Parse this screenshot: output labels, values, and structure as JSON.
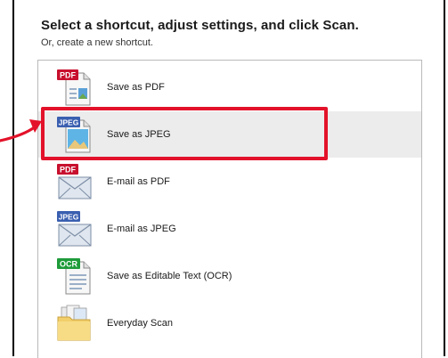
{
  "header": {
    "title": "Select a shortcut, adjust settings, and click Scan.",
    "subtitle": "Or, create a new shortcut."
  },
  "shortcuts": [
    {
      "label": "Save as PDF",
      "badge": "PDF",
      "badge_color": "#c8102e",
      "icon": "pdf-document-icon"
    },
    {
      "label": "Save as JPEG",
      "badge": "JPEG",
      "badge_color": "#3a5fb0",
      "icon": "jpeg-document-icon",
      "selected": true
    },
    {
      "label": "E-mail as PDF",
      "badge": "PDF",
      "badge_color": "#c8102e",
      "icon": "pdf-email-icon"
    },
    {
      "label": "E-mail as JPEG",
      "badge": "JPEG",
      "badge_color": "#3a5fb0",
      "icon": "jpeg-email-icon"
    },
    {
      "label": "Save as Editable Text (OCR)",
      "badge": "OCR",
      "badge_color": "#1e9b3a",
      "icon": "ocr-document-icon"
    },
    {
      "label": "Everyday Scan",
      "icon": "folder-icon"
    }
  ],
  "annotation": {
    "highlight_color": "#e3122a",
    "arrow_color": "#e3122a"
  }
}
